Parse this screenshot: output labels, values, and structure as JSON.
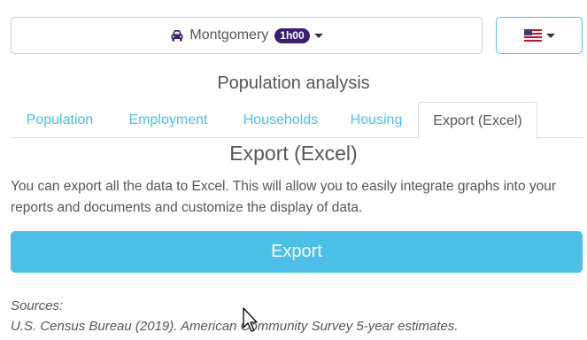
{
  "location": {
    "name": "Montgomery",
    "time_badge": "1h00",
    "icon": "car-icon"
  },
  "language": {
    "icon": "us-flag-icon"
  },
  "section_title": "Population analysis",
  "tabs": [
    {
      "label": "Population",
      "active": false
    },
    {
      "label": "Employment",
      "active": false
    },
    {
      "label": "Households",
      "active": false
    },
    {
      "label": "Housing",
      "active": false
    },
    {
      "label": "Export (Excel)",
      "active": true
    }
  ],
  "export": {
    "title": "Export (Excel)",
    "description": "You can export all the data to Excel. This will allow you to easily integrate graphs into your reports and documents and customize the display of data.",
    "button_label": "Export"
  },
  "sources": {
    "heading": "Sources:",
    "line": "U.S. Census Bureau (2019). American Community Survey 5-year estimates."
  },
  "colors": {
    "accent": "#4bbfe8",
    "badge": "#3a1f6e",
    "text": "#555555"
  }
}
